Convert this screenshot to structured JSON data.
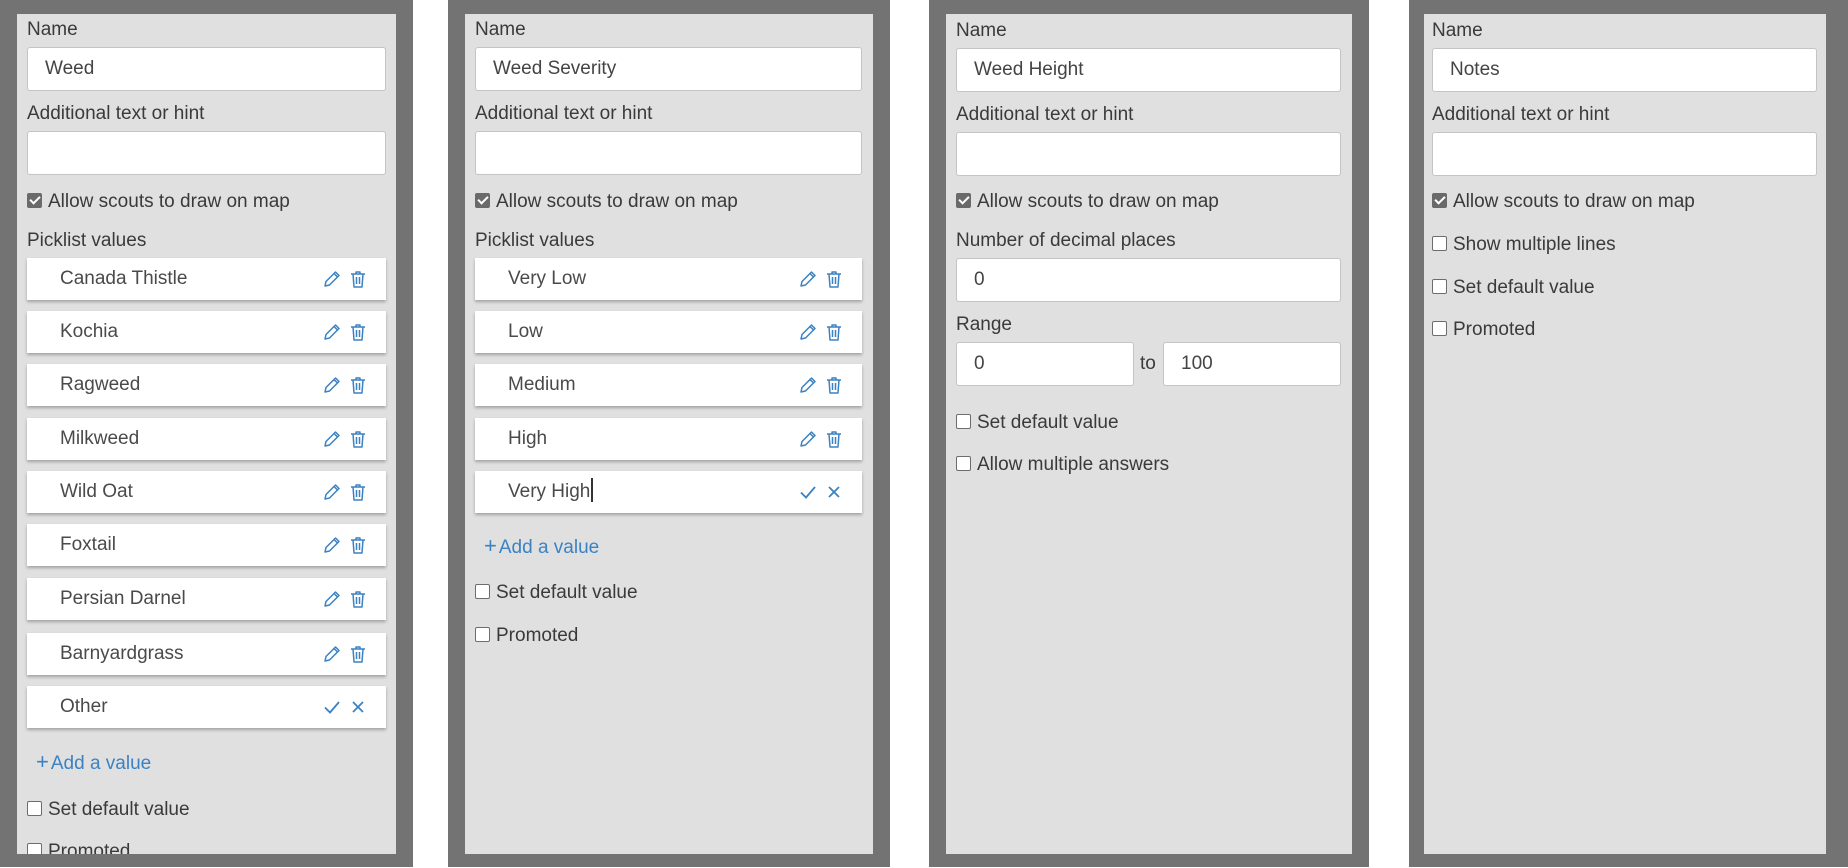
{
  "panels": [
    {
      "name_label": "Name",
      "name_value": "Weed",
      "hint_label": "Additional text or hint",
      "hint_value": "",
      "draw_on_map_label": "Allow scouts to draw on map",
      "picklist_label": "Picklist values",
      "picklist": [
        "Canada Thistle",
        "Kochia",
        "Ragweed",
        "Milkweed",
        "Wild Oat",
        "Foxtail",
        "Persian Darnel",
        "Barnyardgrass"
      ],
      "editing_value": "Other",
      "add_value_label": "Add a value",
      "set_default_label": "Set default value",
      "promoted_label": "Promoted"
    },
    {
      "name_label": "Name",
      "name_value": "Weed Severity",
      "hint_label": "Additional text or hint",
      "hint_value": "",
      "draw_on_map_label": "Allow scouts to draw on map",
      "picklist_label": "Picklist values",
      "picklist": [
        "Very Low",
        "Low",
        "Medium",
        "High"
      ],
      "editing_value": "Very High",
      "add_value_label": "Add a value",
      "set_default_label": "Set default value",
      "promoted_label": "Promoted"
    },
    {
      "name_label": "Name",
      "name_value": "Weed Height",
      "hint_label": "Additional text or hint",
      "hint_value": "",
      "draw_on_map_label": "Allow scouts to draw on map",
      "decimal_label": "Number of decimal places",
      "decimal_value": "0",
      "range_label": "Range",
      "range_min": "0",
      "range_to": "to",
      "range_max": "100",
      "set_default_label": "Set default value",
      "multiple_answers_label": "Allow multiple answers"
    },
    {
      "name_label": "Name",
      "name_value": "Notes",
      "hint_label": "Additional text or hint",
      "hint_value": "",
      "draw_on_map_label": "Allow scouts to draw on map",
      "multiple_lines_label": "Show multiple lines",
      "set_default_label": "Set default value",
      "promoted_label": "Promoted"
    }
  ],
  "checks": {
    "draw_on_map": true,
    "set_default": false,
    "promoted": false,
    "multiple_answers": false,
    "multiple_lines": false
  },
  "colors": {
    "frame": "#737373",
    "panel": "#e0e0e0",
    "accent": "#3b82c4",
    "checkbox_checked": "#6a6a6a"
  },
  "icons": {
    "edit": "pencil-icon",
    "delete": "trash-icon",
    "confirm": "check-icon",
    "cancel": "close-icon",
    "add": "plus-icon"
  }
}
